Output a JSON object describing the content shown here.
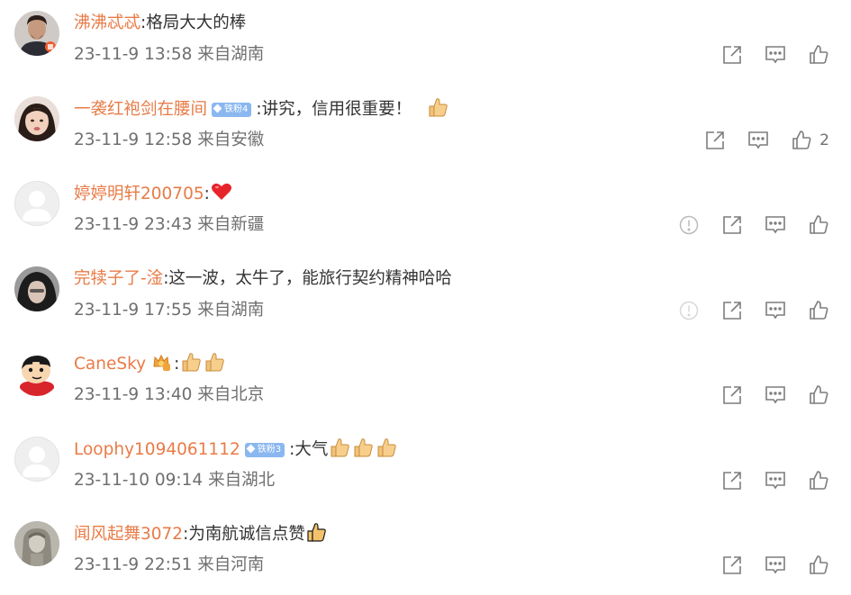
{
  "comments": [
    {
      "username": "沸沸忒忒",
      "text": "格局大大的棒",
      "time": "23-11-9 13:58",
      "location": "来自湖南",
      "likes": ""
    },
    {
      "username": "一袭红袍剑在腰间",
      "badge": "铁粉4",
      "text": "讲究，信用很重要！",
      "time": "23-11-9 12:58",
      "location": "来自安徽",
      "likes": "2"
    },
    {
      "username": "婷婷明轩200705",
      "text": "",
      "time": "23-11-9 23:43",
      "location": "来自新疆",
      "likes": ""
    },
    {
      "username": "完犊子了-淦",
      "text": "这一波，太牛了，能旅行契约精神哈哈",
      "time": "23-11-9 17:55",
      "location": "来自湖南",
      "likes": ""
    },
    {
      "username": "CaneSky",
      "text": "",
      "time": "23-11-9 13:40",
      "location": "来自北京",
      "likes": ""
    },
    {
      "username": "Loophy1094061112",
      "badge": "铁粉3",
      "text": "大气",
      "time": "23-11-10 09:14",
      "location": "来自湖北",
      "likes": ""
    },
    {
      "username": "闻风起舞3072",
      "text": "为南航诚信点赞",
      "time": "23-11-9 22:51",
      "location": "来自河南",
      "likes": ""
    }
  ],
  "separator": ":",
  "icons": {
    "share": "share-icon",
    "comment": "comment-icon",
    "like": "thumbs-up-icon",
    "report": "report-icon",
    "emoji_thumb": "thumbs-up-emoji",
    "emoji_heart": "heart-emoji"
  },
  "colors": {
    "username": "#e87b47",
    "text": "#333333",
    "meta": "#6f6f6f",
    "icon": "#7d7d7d",
    "badge": "#8ab7f0",
    "heart": "#e8242b"
  }
}
